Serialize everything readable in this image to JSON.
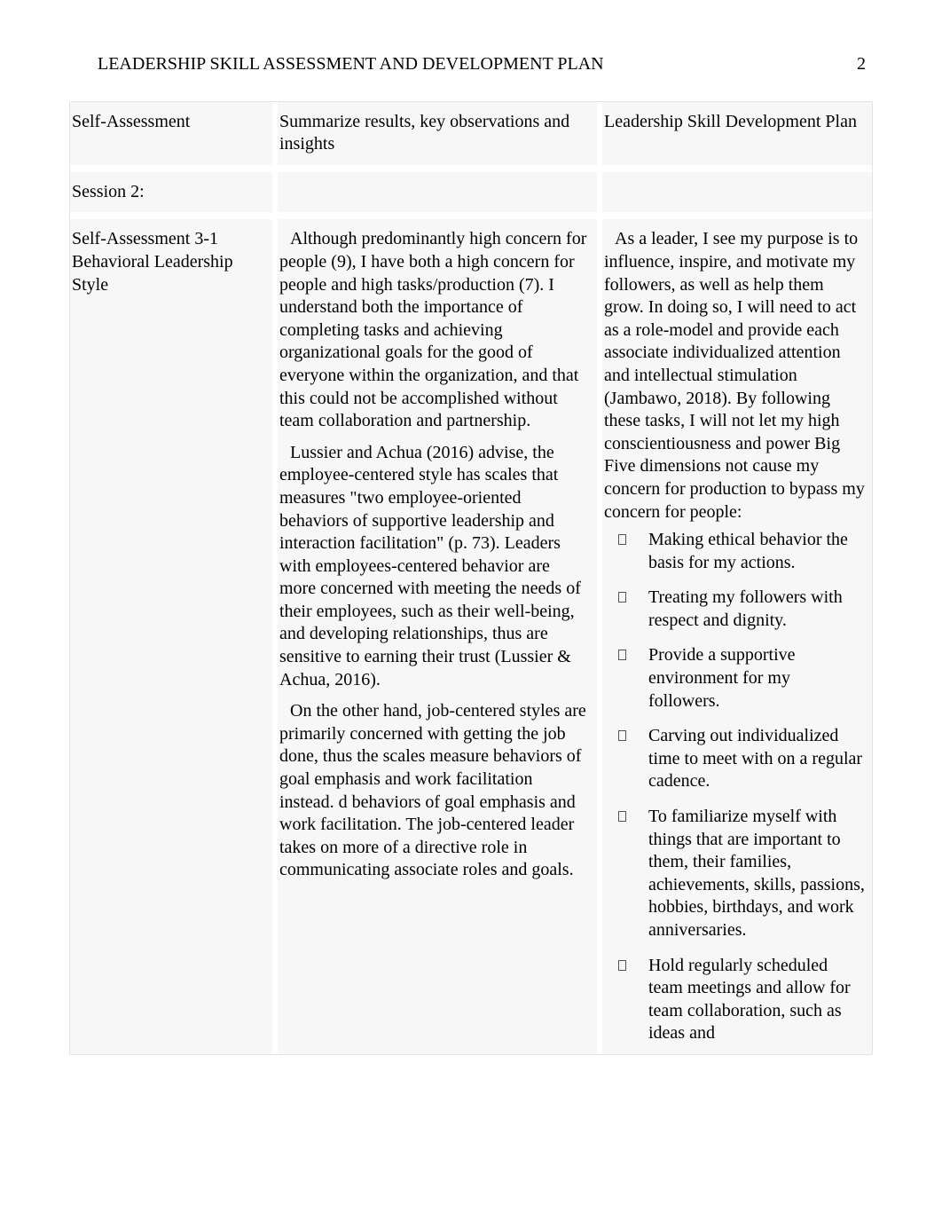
{
  "header": {
    "running_title": "LEADERSHIP SKILL ASSESSMENT AND DEVELOPMENT PLAN",
    "page_number": "2"
  },
  "columns": {
    "col1": "Self-Assessment",
    "col2": "Summarize results, key observations and insights",
    "col3": "Leadership Skill Development Plan"
  },
  "session_row": {
    "label": "Session 2:"
  },
  "body_row": {
    "col1_line1": "Self-Assessment 3-1",
    "col1_line2": "Behavioral Leadership Style",
    "col2_p1": " Although predominantly high concern for people (9), I have both a high concern for people and high tasks/production (7). I understand both the importance of completing tasks and achieving organizational goals for the good of everyone within the organization, and that this could not be accomplished without  team collaboration and partnership.",
    "col2_p2": " Lussier and Achua (2016) advise, the employee-centered style has scales that measures \"two employee-oriented behaviors of supportive leadership and interaction facilitation\" (p. 73). Leaders with employees-centered behavior are more concerned with meeting the needs of their employees, such as their well-being, and developing relationships, thus are sensitive to earning their trust (Lussier & Achua, 2016).",
    "col2_p3": " On the other hand, job-centered styles are primarily concerned with getting the job done, thus the scales measure behaviors of goal emphasis and work facilitation instead. d behaviors of goal emphasis and work facilitation. The job-centered leader takes on more of a directive role in communicating associate roles and goals.",
    "col3_intro": " As a leader, I see my purpose is to influence, inspire, and motivate my followers, as well as help them grow. In doing so, I will need to act as a role-model and provide each associate individualized attention and intellectual stimulation (Jambawo, 2018). By following these tasks, I will not let my high conscientiousness and power Big Five dimensions not cause my concern for production to bypass my concern for people:",
    "col3_items": [
      "Making ethical behavior the basis for my actions.",
      "Treating my followers with respect and dignity.",
      "Provide a supportive environment for my followers.",
      "Carving out individualized time to meet with on a regular cadence.",
      "To familiarize myself with things that are important to them, their families, achievements, skills, passions, hobbies, birthdays, and work anniversaries.",
      "Hold regularly scheduled team meetings and allow for team collaboration, such as ideas and"
    ]
  }
}
